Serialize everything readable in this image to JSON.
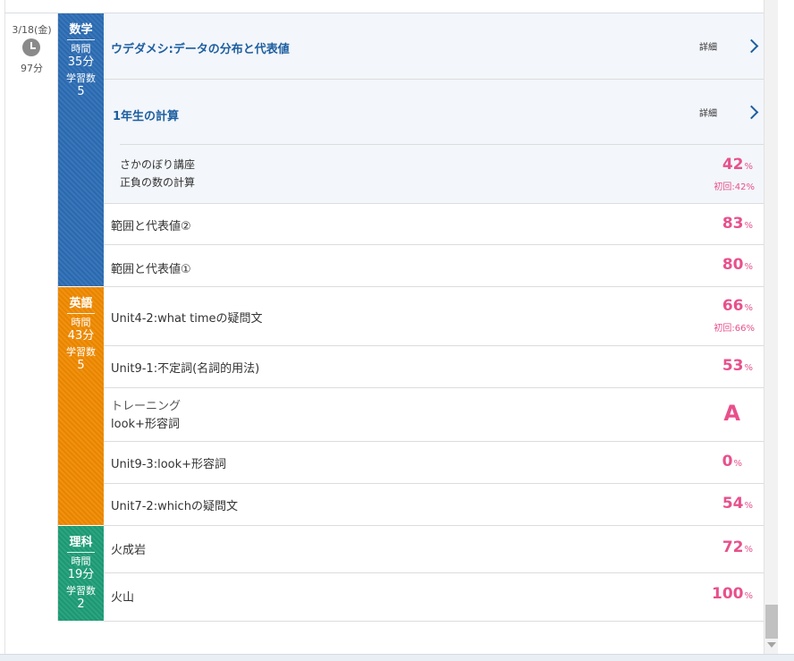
{
  "day": {
    "date": "3/18(金)",
    "minutes": "97分",
    "icon": "clock-icon"
  },
  "subjects": [
    {
      "name": "数学",
      "time_label": "時間",
      "time": "35分",
      "count_label": "学習数",
      "count": "5",
      "color": "#2d6db5"
    },
    {
      "name": "英語",
      "time_label": "時間",
      "time": "43分",
      "count_label": "学習数",
      "count": "5",
      "color": "#f08a00"
    },
    {
      "name": "理科",
      "time_label": "時間",
      "time": "19分",
      "count_label": "学習数",
      "count": "2",
      "color": "#1e9e77"
    }
  ],
  "math": {
    "units": [
      {
        "title": "ウデダメシ:データの分布と代表値",
        "detail": "詳細"
      },
      {
        "title": "1年生の計算",
        "detail": "詳細"
      }
    ],
    "sub_item": {
      "line1": "さかのぼり講座",
      "line2": "正負の数の計算",
      "score": "42",
      "unit": "%",
      "first": "初回:42%"
    },
    "rows": [
      {
        "title": "範囲と代表値②",
        "score": "83",
        "unit": "%"
      },
      {
        "title": "範囲と代表値①",
        "score": "80",
        "unit": "%"
      }
    ]
  },
  "english": {
    "rows": [
      {
        "title": "Unit4-2:what timeの疑問文",
        "score": "66",
        "unit": "%",
        "first": "初回:66%"
      },
      {
        "title": "Unit9-1:不定詞(名詞的用法)",
        "score": "53",
        "unit": "%"
      },
      {
        "line1": "トレーニング",
        "line2": "look+形容詞",
        "grade": "A"
      },
      {
        "title": "Unit9-3:look+形容詞",
        "score": "0",
        "unit": "%"
      },
      {
        "title": "Unit7-2:whichの疑問文",
        "score": "54",
        "unit": "%"
      }
    ]
  },
  "science": {
    "rows": [
      {
        "title": "火成岩",
        "score": "72",
        "unit": "%"
      },
      {
        "title": "火山",
        "score": "100",
        "unit": "%"
      }
    ]
  },
  "colors": {
    "accent_score": "#e8508c",
    "unit_title": "#1d5fa0"
  }
}
